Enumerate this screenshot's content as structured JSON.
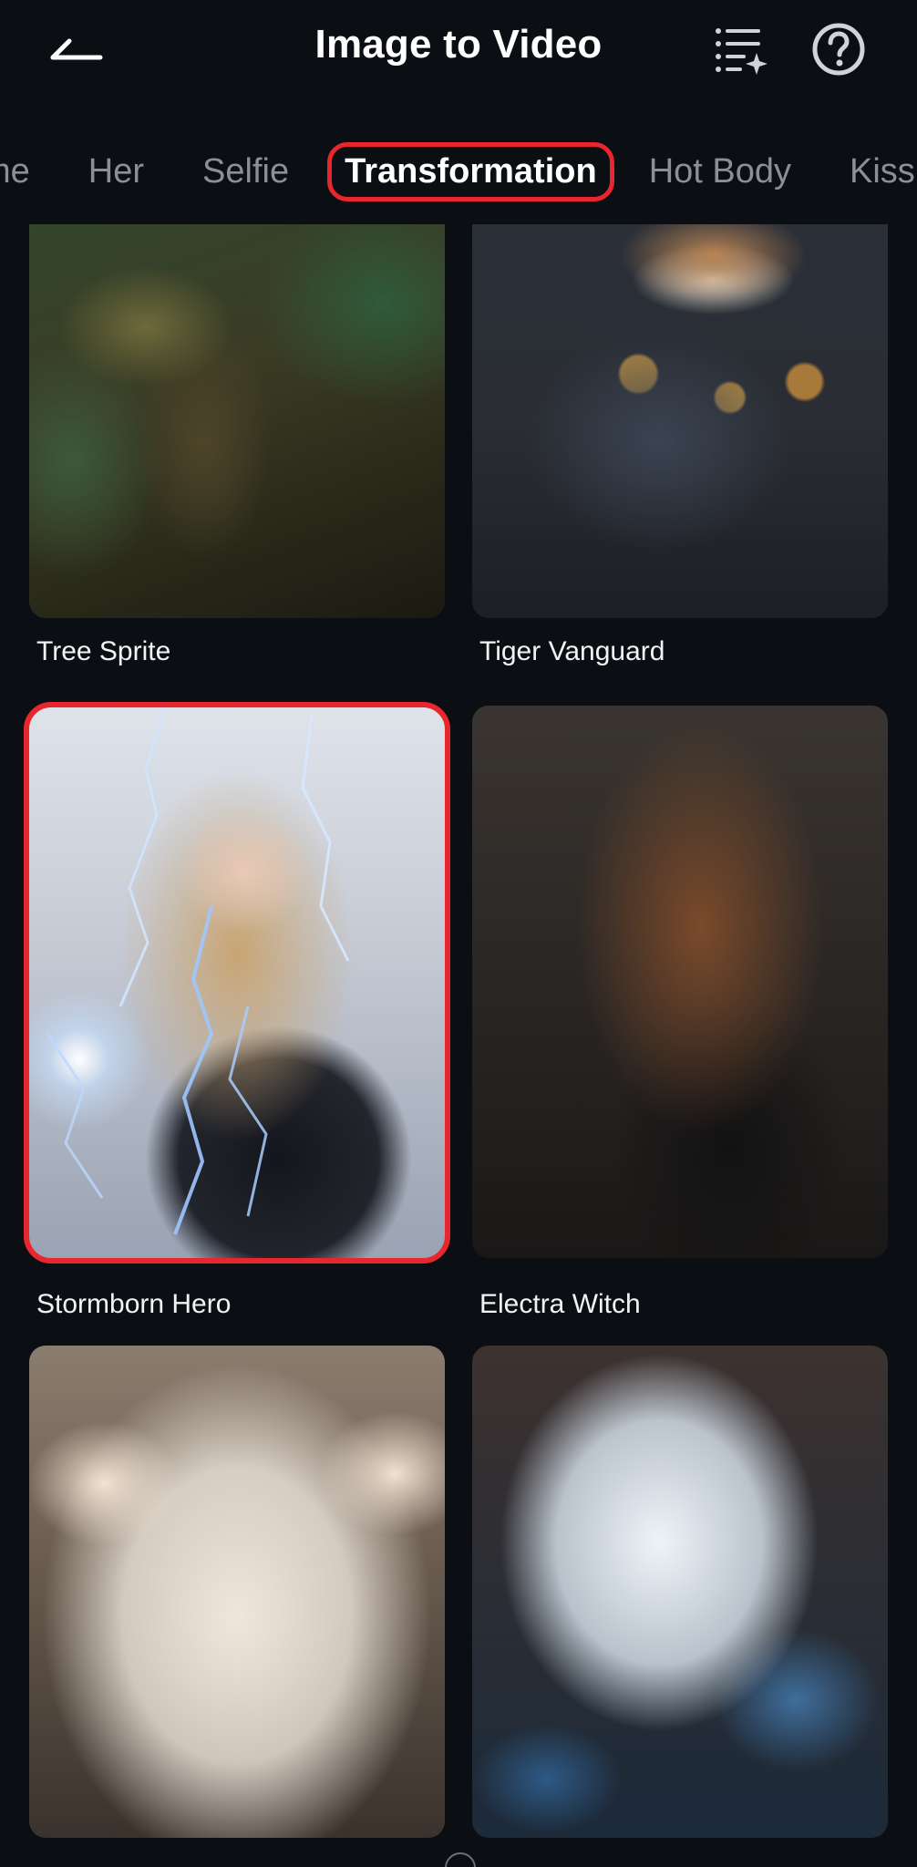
{
  "header": {
    "title": "Image to Video",
    "back_icon": "back-arrow-icon",
    "list_icon": "sparkle-list-icon",
    "help_icon": "question-circle-icon"
  },
  "tabs": [
    {
      "label": "me",
      "active": false
    },
    {
      "label": "Her",
      "active": false
    },
    {
      "label": "Selfie",
      "active": false
    },
    {
      "label": "Transformation",
      "active": true
    },
    {
      "label": "Hot Body",
      "active": false
    },
    {
      "label": "Kiss",
      "active": false
    }
  ],
  "cards": [
    {
      "label": "Tree Sprite",
      "selected": false
    },
    {
      "label": "Tiger Vanguard",
      "selected": false
    },
    {
      "label": "Stormborn Hero",
      "selected": true
    },
    {
      "label": "Electra Witch",
      "selected": false
    },
    {
      "label": "",
      "selected": false
    },
    {
      "label": "",
      "selected": false
    }
  ],
  "colors": {
    "background": "#0b0e13",
    "highlight": "#e8262d",
    "inactive_tab": "#8a8f98",
    "text": "#f2f3f5"
  }
}
